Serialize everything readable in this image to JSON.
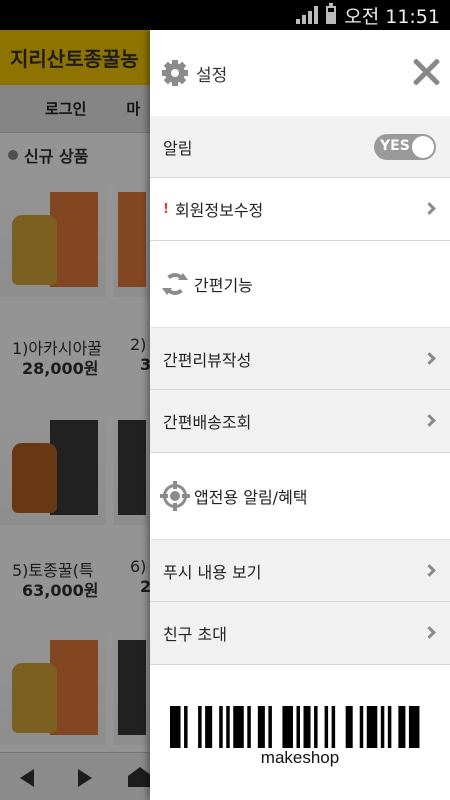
{
  "status_bar": {
    "time": "오전 11:51",
    "icons": [
      "signal-icon",
      "battery-icon"
    ]
  },
  "background_app": {
    "store_title": "지리산토종꿀농",
    "nav": [
      "로그인",
      "마"
    ],
    "section_title": "신규 상품",
    "products": [
      {
        "name": "1)아카시아꿀",
        "price": "28,000원"
      },
      {
        "name": "2)",
        "price": "3"
      },
      {
        "name": "5)토종꿀(특",
        "price": "63,000원"
      },
      {
        "name": "6)",
        "price": "2"
      }
    ]
  },
  "menu": {
    "title": "설정",
    "notification": {
      "label": "알림",
      "toggle_value": "YES"
    },
    "member_edit": {
      "label": "회원정보수정",
      "badge": "!"
    },
    "quick_section": "간편기능",
    "quick_items": [
      "간편리뷰작성",
      "간편배송조회"
    ],
    "app_section": "앱전용 알림/혜택",
    "app_items": [
      "푸시 내용 보기",
      "친구 초대"
    ]
  },
  "barcode": {
    "label": "makeshop",
    "bars": [
      3,
      1,
      1,
      3,
      1,
      1,
      2,
      2,
      1,
      1,
      1,
      1,
      3,
      1,
      1,
      2,
      2,
      1,
      1,
      3,
      3,
      1,
      1,
      1,
      2,
      1,
      1,
      2,
      1,
      1,
      1,
      3,
      2,
      2,
      1,
      1,
      3,
      1,
      1,
      1,
      1,
      2,
      2,
      1,
      3,
      3
    ]
  },
  "colors": {
    "store_header": "#f7c600",
    "toggle": "#9a9a9a",
    "badge": "#e03c3c"
  }
}
